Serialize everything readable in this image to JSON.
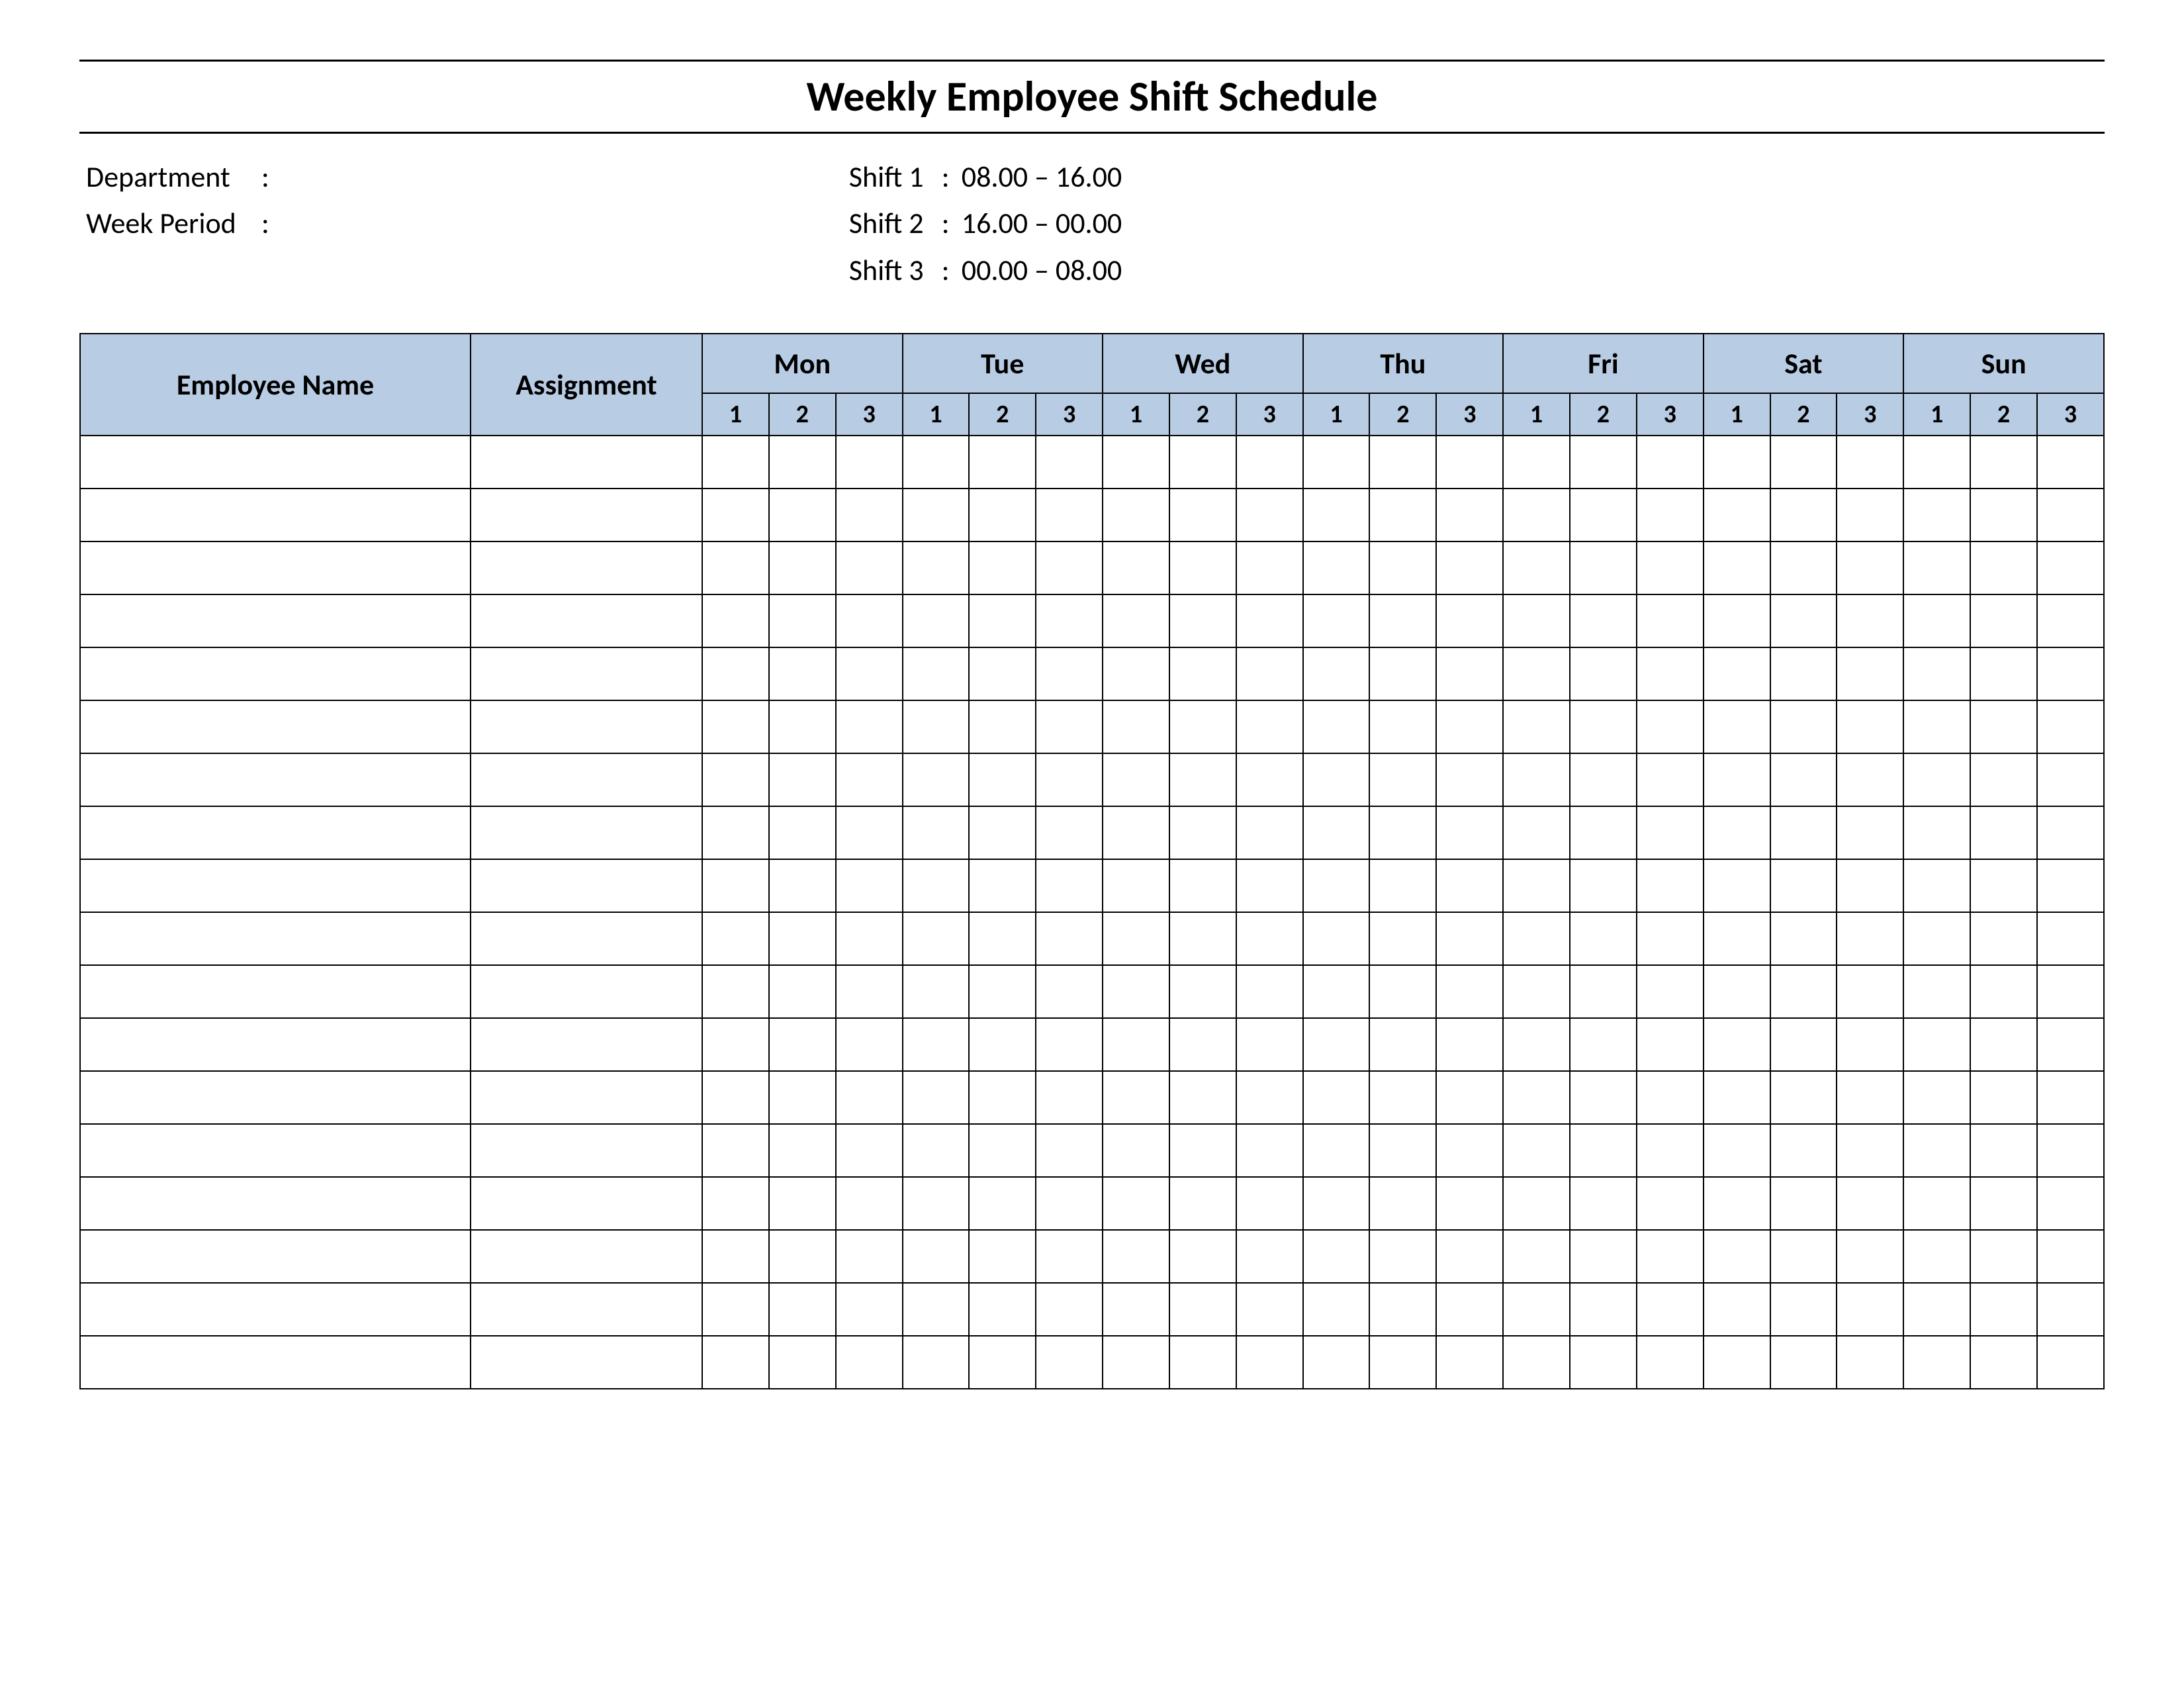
{
  "title": "Weekly Employee Shift Schedule",
  "info_left": {
    "department": {
      "label": "Department",
      "value": ""
    },
    "week_period": {
      "label": "Week  Period",
      "value": ""
    }
  },
  "shifts": [
    {
      "label": "Shift 1",
      "range": "08.00  – 16.00"
    },
    {
      "label": "Shift 2",
      "range": "16.00  – 00.00"
    },
    {
      "label": "Shift 3",
      "range": "00.00  – 08.00"
    }
  ],
  "headers": {
    "employee_name": "Employee Name",
    "assignment": "Assignment",
    "days": [
      "Mon",
      "Tue",
      "Wed",
      "Thu",
      "Fri",
      "Sat",
      "Sun"
    ],
    "sub": [
      "1",
      "2",
      "3"
    ]
  },
  "row_count": 18
}
